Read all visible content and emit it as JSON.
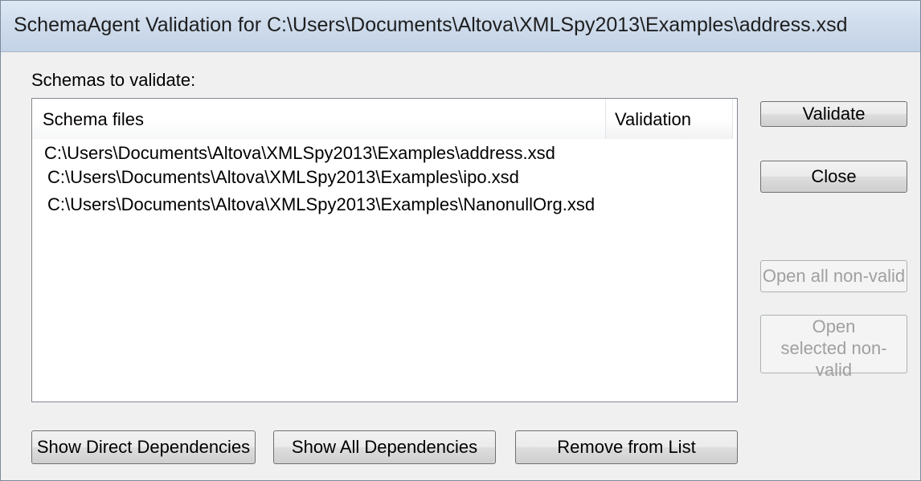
{
  "window": {
    "title": "SchemaAgent Validation for C:\\Users\\Documents\\Altova\\XMLSpy2013\\Examples\\address.xsd"
  },
  "main": {
    "schemas_label": "Schemas to validate:",
    "columns": {
      "files": "Schema files",
      "validation": "Validation"
    },
    "rows": [
      {
        "file": "C:\\Users\\Documents\\Altova\\XMLSpy2013\\Examples\\address.xsd",
        "validation": ""
      },
      {
        "file": "C:\\Users\\Documents\\Altova\\XMLSpy2013\\Examples\\ipo.xsd",
        "validation": ""
      },
      {
        "file": "C:\\Users\\Documents\\Altova\\XMLSpy2013\\Examples\\NanonullOrg.xsd",
        "validation": ""
      }
    ]
  },
  "buttons": {
    "validate": "Validate",
    "close": "Close",
    "open_all_nonvalid": "Open all non-valid",
    "open_selected_nonvalid": "Open selected non-valid",
    "show_direct_deps": "Show Direct Dependencies",
    "show_all_deps": "Show All Dependencies",
    "remove_from_list": "Remove from List"
  },
  "state": {
    "open_all_nonvalid_enabled": false,
    "open_selected_nonvalid_enabled": false
  }
}
